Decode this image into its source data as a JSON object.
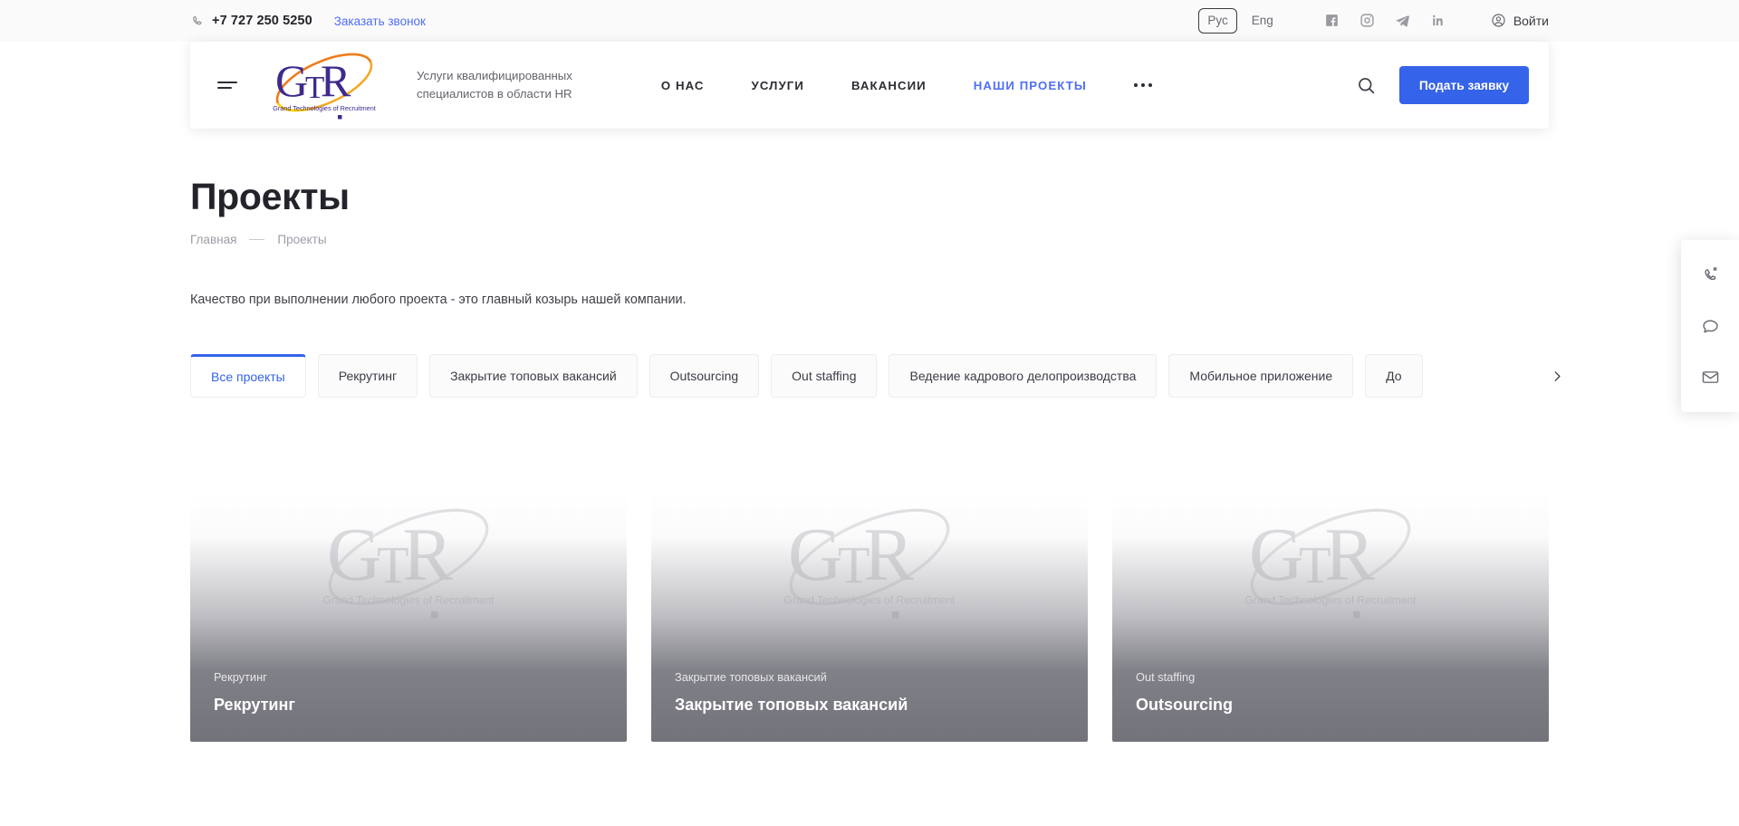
{
  "topbar": {
    "phone": "+7 727 250 5250",
    "phone_icon": "phone-icon",
    "callback_label": "Заказать звонок",
    "languages": [
      {
        "label": "Рус",
        "active": true
      },
      {
        "label": "Eng",
        "active": false
      }
    ],
    "socials": [
      {
        "name": "facebook-icon"
      },
      {
        "name": "instagram-icon"
      },
      {
        "name": "telegram-icon"
      },
      {
        "name": "linkedin-icon"
      }
    ],
    "login_label": "Войти",
    "login_icon": "user-circle-icon"
  },
  "header": {
    "menu_icon": "hamburger-icon",
    "logo": {
      "monogram": "GTR",
      "caption": "Grand Technologies of Recruitment",
      "letter_color": "#3f2a8c",
      "swoosh_colors": [
        "#f5a623",
        "#f07c1e",
        "#ffd100"
      ]
    },
    "tagline_line1": "Услуги квалифицированных",
    "tagline_line2": "специалистов в области HR",
    "nav": [
      {
        "label": "О НАС",
        "active": false
      },
      {
        "label": "УСЛУГИ",
        "active": false
      },
      {
        "label": "ВАКАНСИИ",
        "active": false
      },
      {
        "label": "НАШИ ПРОЕКТЫ",
        "active": true
      }
    ],
    "more_icon": "ellipsis-icon",
    "search_icon": "search-icon",
    "apply_label": "Подать заявку",
    "accent_color": "#3563e9"
  },
  "main": {
    "title": "Проекты",
    "breadcrumb": [
      {
        "label": "Главная",
        "current": false
      },
      {
        "label": "Проекты",
        "current": true
      }
    ],
    "intro": "Качество при выполнении любого проекта - это главный козырь нашей компании.",
    "tabs": [
      {
        "label": "Все проекты",
        "active": true
      },
      {
        "label": "Рекрутинг",
        "active": false
      },
      {
        "label": "Закрытие топовых вакансий",
        "active": false
      },
      {
        "label": "Outsourcing",
        "active": false
      },
      {
        "label": "Out staffing",
        "active": false
      },
      {
        "label": "Ведение кадрового делопроизводства",
        "active": false
      },
      {
        "label": "Мобильное приложение",
        "active": false
      },
      {
        "label": "До",
        "active": false
      }
    ],
    "tabs_next_icon": "chevron-right-icon",
    "cards": [
      {
        "category": "Рекрутинг",
        "title": "Рекрутинг"
      },
      {
        "category": "Закрытие топовых вакансий",
        "title": "Закрытие топовых вакансий"
      },
      {
        "category": "Out staffing",
        "title": "Outsourcing"
      }
    ]
  },
  "side_widget": {
    "buttons": [
      {
        "name": "callback-phone-icon"
      },
      {
        "name": "chat-icon"
      },
      {
        "name": "email-icon"
      }
    ]
  }
}
